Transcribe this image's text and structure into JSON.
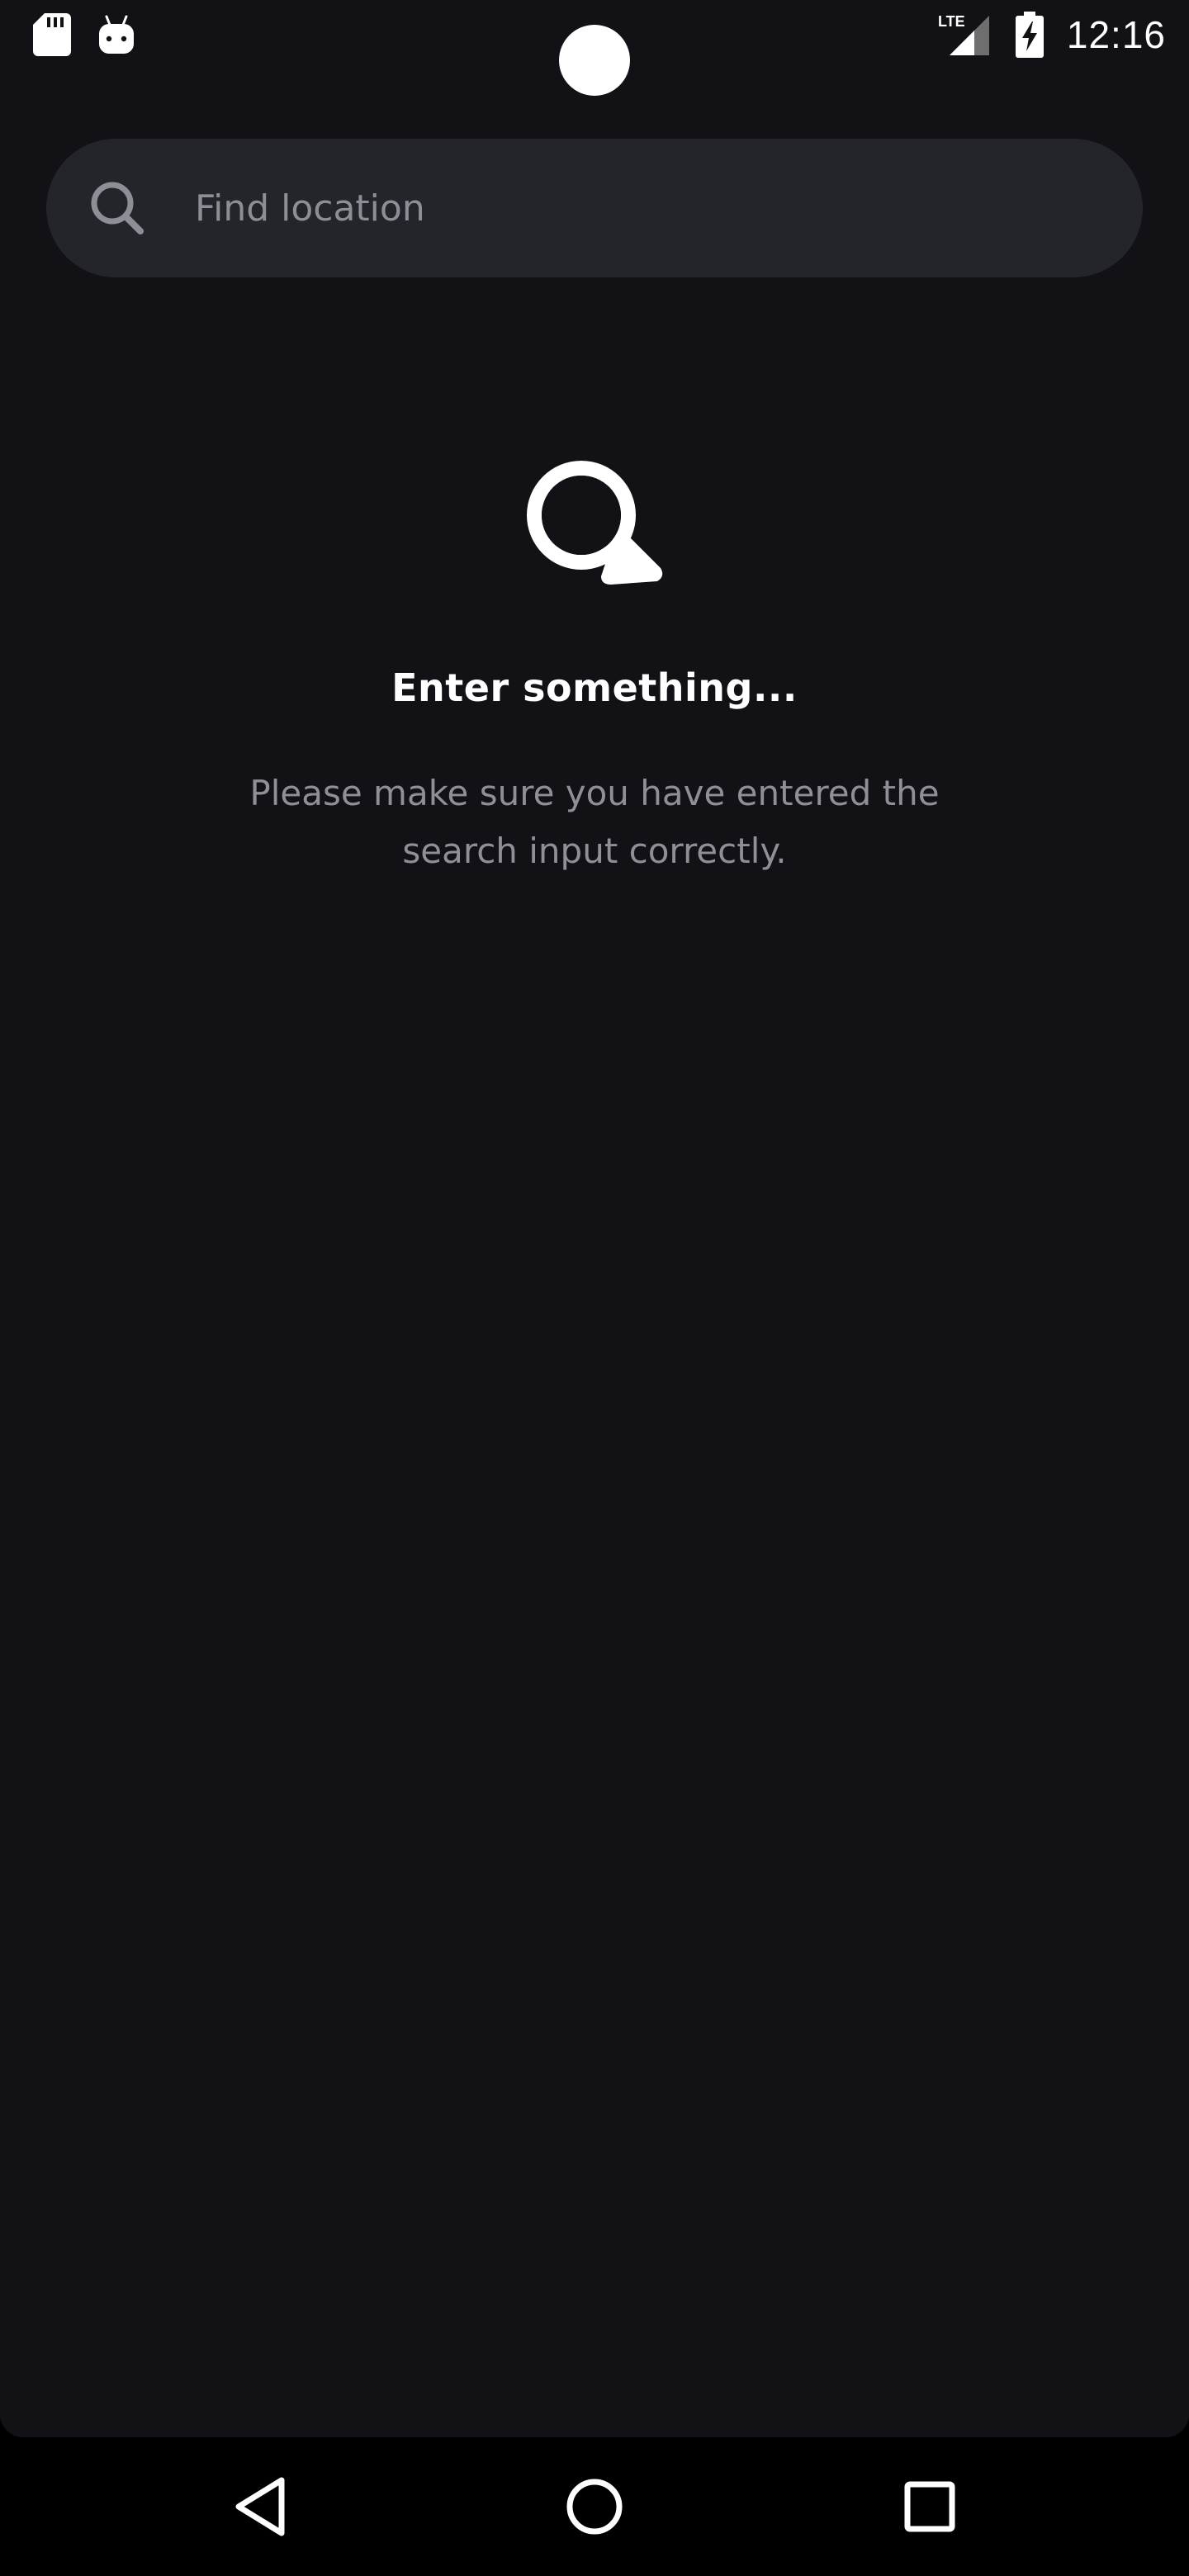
{
  "status_bar": {
    "time": "12:16",
    "network_label": "LTE",
    "left_icons": [
      "sd-card-icon",
      "android-icon"
    ],
    "right_icons": [
      "lte-signal-icon",
      "battery-charging-icon"
    ]
  },
  "search": {
    "placeholder": "Find location",
    "value": "",
    "icon": "search-icon"
  },
  "empty_state": {
    "icon": "magnifier-icon",
    "title": "Enter something...",
    "message": "Please make sure you have entered the search input correctly."
  },
  "nav_bar": {
    "buttons": [
      "back-icon",
      "home-icon",
      "recents-icon"
    ]
  },
  "colors": {
    "background": "#121116",
    "search_bar": "#23252b",
    "title_text": "#ffffff",
    "secondary_text": "#8f9096",
    "placeholder_text": "#8c8f96",
    "nav_bar": "#000000"
  }
}
